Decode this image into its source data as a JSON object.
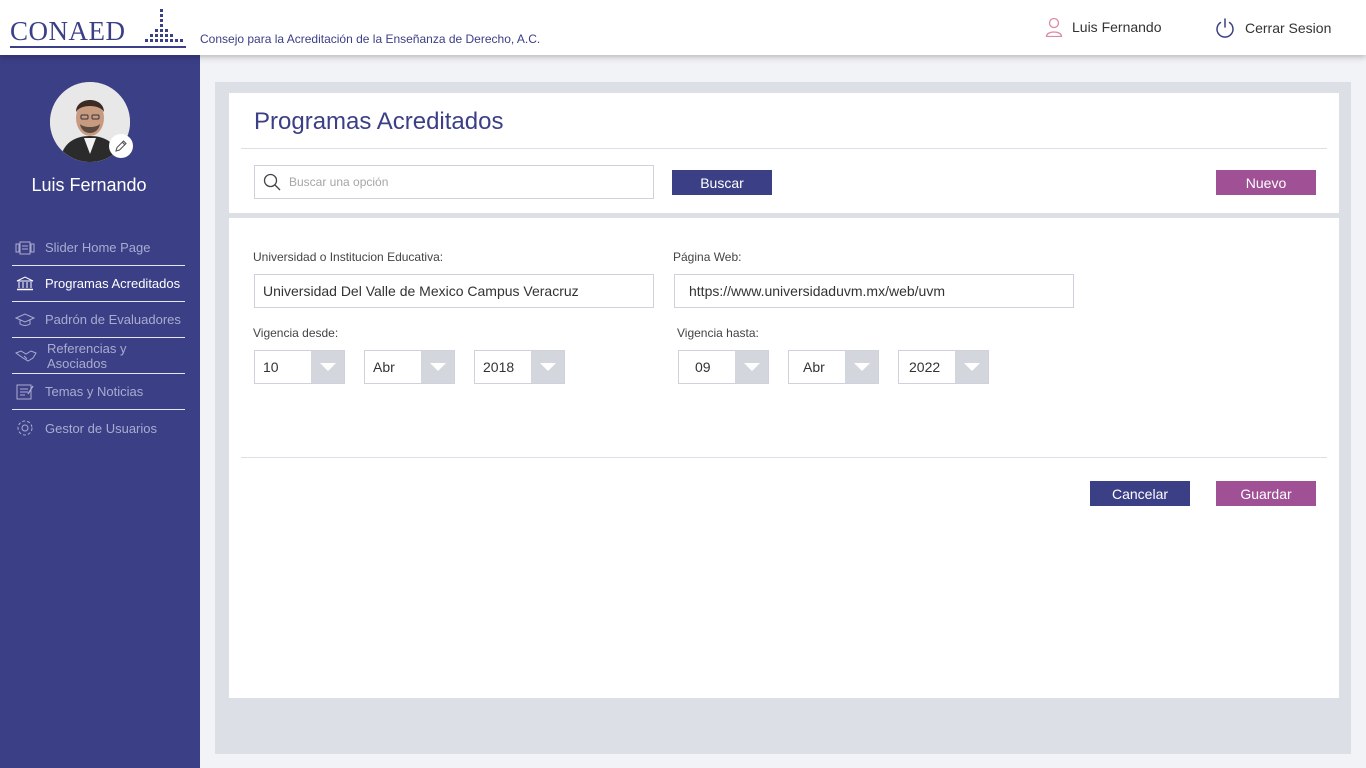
{
  "header": {
    "logo_text": "CONAED",
    "tagline": "Consejo para la Acreditación de la Enseñanza de Derecho, A.C.",
    "user_name": "Luis Fernando",
    "logout_label": "Cerrar Sesion",
    "user_icon": "user-icon",
    "logout_icon": "power-icon"
  },
  "sidebar": {
    "profile_name": "Luis Fernando",
    "avatar_edit_icon": "pencil-icon",
    "items": [
      {
        "label": "Slider Home Page",
        "icon": "slider-icon",
        "active": false
      },
      {
        "label": "Programas Acreditados",
        "icon": "bank-icon",
        "active": true
      },
      {
        "label": "Padrón de Evaluadores",
        "icon": "graduation-cap-icon",
        "active": false
      },
      {
        "label": "Referencias y Asociados",
        "icon": "handshake-icon",
        "active": false
      },
      {
        "label": "Temas y Noticias",
        "icon": "news-icon",
        "active": false
      },
      {
        "label": "Gestor de Usuarios",
        "icon": "gear-icon",
        "active": false
      }
    ]
  },
  "main": {
    "title": "Programas Acreditados",
    "search_placeholder": "Buscar una opción",
    "search_button": "Buscar",
    "new_button": "Nuevo"
  },
  "form": {
    "university_label": "Universidad o Institucion Educativa:",
    "university_value": "Universidad Del Valle de Mexico Campus Veracruz",
    "website_label": "Página Web:",
    "website_value": "https://www.universidaduvm.mx/web/uvm",
    "valid_from_label": "Vigencia desde:",
    "valid_from": {
      "day": "10",
      "month": "Abr",
      "year": "2018"
    },
    "valid_to_label": "Vigencia hasta:",
    "valid_to": {
      "day": "09",
      "month": "Abr",
      "year": "2022"
    },
    "cancel_button": "Cancelar",
    "save_button": "Guardar"
  },
  "colors": {
    "primary": "#3b3f86",
    "accent": "#a05095",
    "panel_bg": "#dcdfe6"
  }
}
